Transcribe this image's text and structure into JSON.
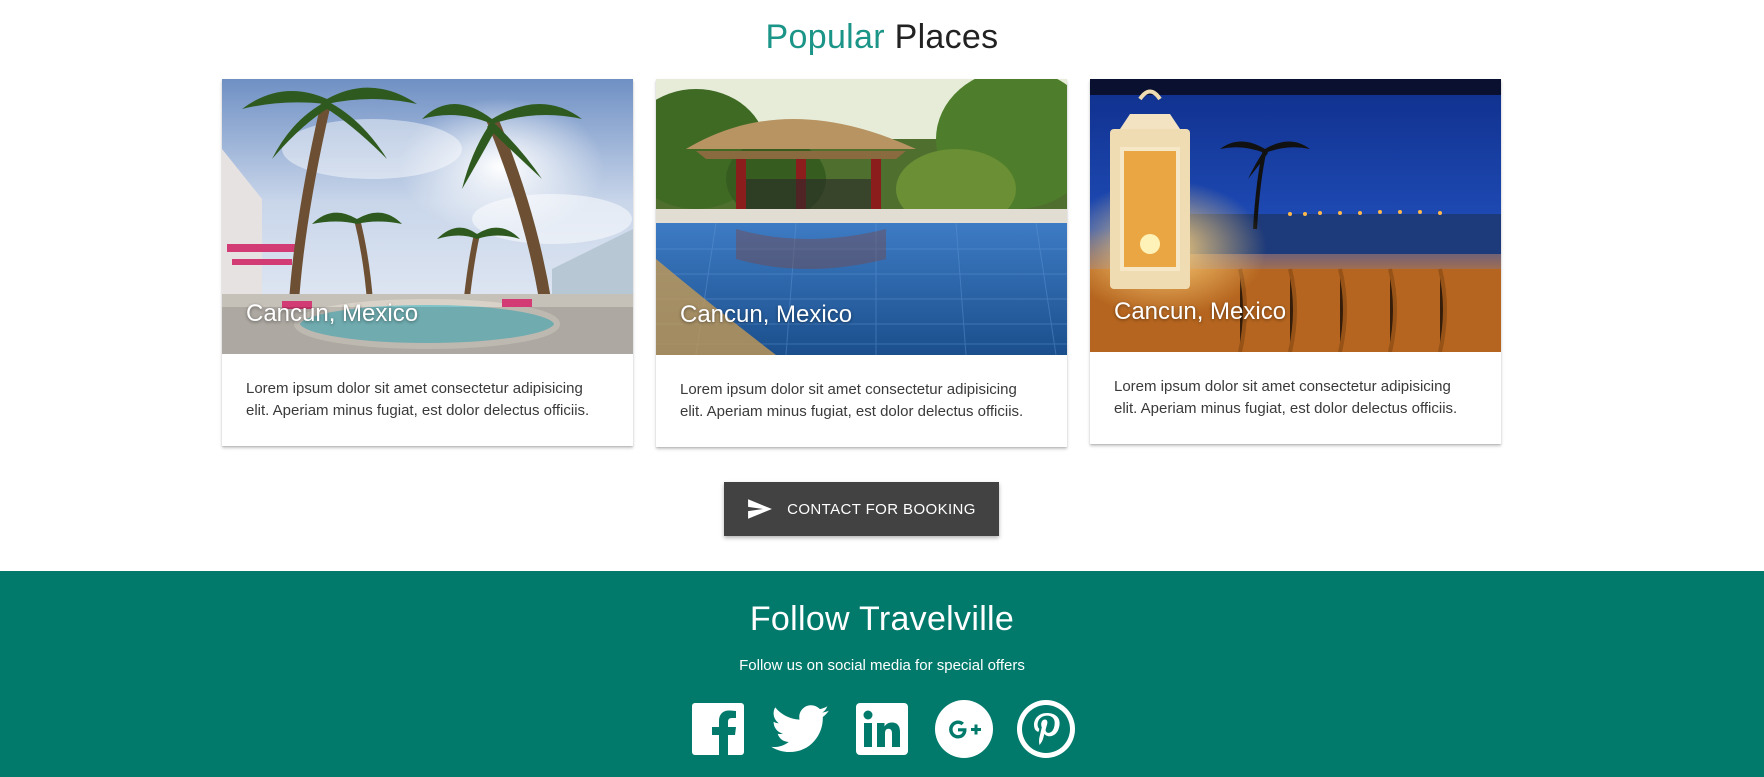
{
  "popular": {
    "title_accent": "Popular",
    "title_rest": "Places",
    "accent_color": "#1b9587",
    "cards": [
      {
        "caption": "Cancun, Mexico",
        "text": "Lorem ipsum dolor sit amet consectetur adipisicing elit. Aperiam minus fugiat, est dolor delectus officiis."
      },
      {
        "caption": "Cancun, Mexico",
        "text": "Lorem ipsum dolor sit amet consectetur adipisicing elit. Aperiam minus fugiat, est dolor delectus officiis."
      },
      {
        "caption": "Cancun, Mexico",
        "text": "Lorem ipsum dolor sit amet consectetur adipisicing elit. Aperiam minus fugiat, est dolor delectus officiis."
      }
    ],
    "cta_label": "CONTACT FOR BOOKING",
    "cta_icon": "send-icon"
  },
  "footer": {
    "title": "Follow Travelville",
    "subtitle": "Follow us on social media for special offers",
    "background": "#017a6c",
    "social": [
      "facebook-icon",
      "twitter-icon",
      "linkedin-icon",
      "google-plus-icon",
      "pinterest-icon"
    ]
  }
}
